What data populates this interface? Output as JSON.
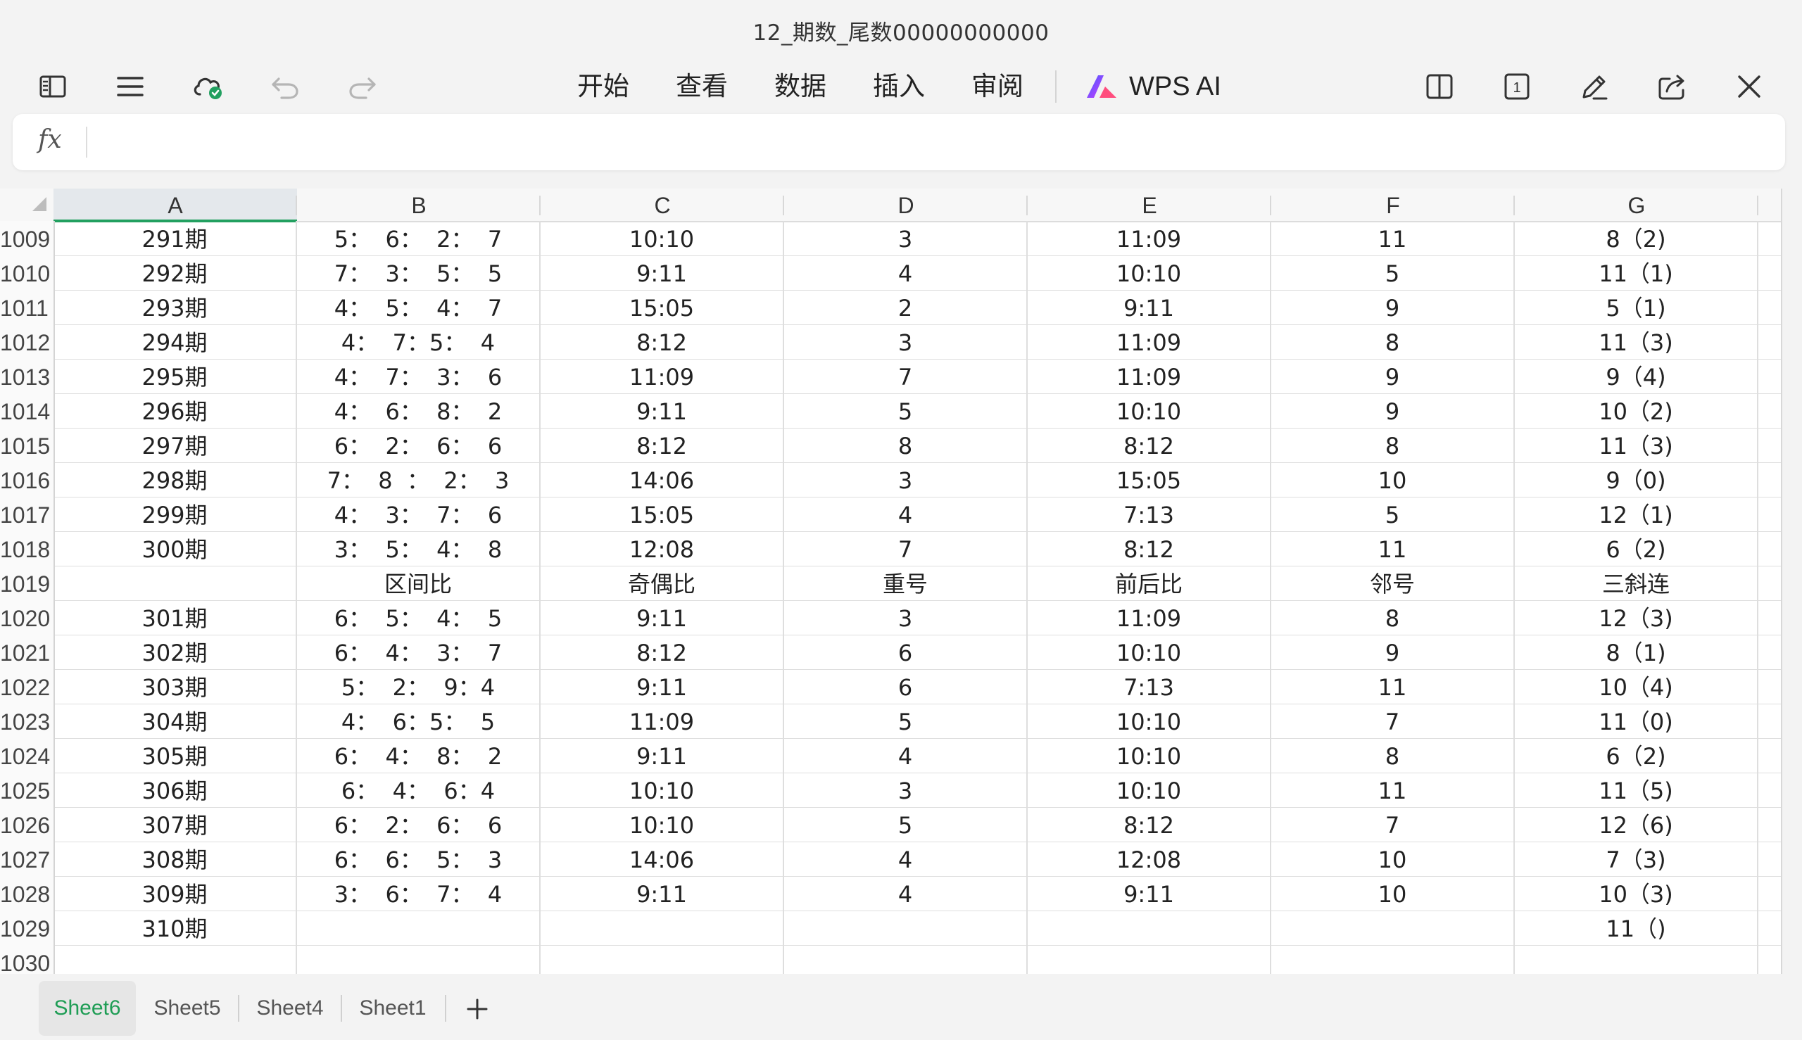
{
  "window": {
    "title": "12_期数_尾数00000000000"
  },
  "toolbar": {
    "left_icons": [
      "sidebar-toggle-icon",
      "menu-icon",
      "cloud-sync-icon",
      "undo-icon",
      "redo-icon"
    ],
    "menu": [
      "开始",
      "查看",
      "数据",
      "插入",
      "审阅"
    ],
    "ai_label": "WPS AI",
    "right_icons": [
      "split-view-icon",
      "page-count-icon",
      "pen-edit-icon",
      "share-icon",
      "close-icon"
    ],
    "page_count": "1"
  },
  "formula_bar": {
    "fx_label": "fx",
    "value": ""
  },
  "columns": [
    "A",
    "B",
    "C",
    "D",
    "E",
    "F",
    "G"
  ],
  "selected_column": "A",
  "rows": [
    {
      "n": "1009",
      "cells": [
        "291期",
        "5：  6：  2：  7",
        "10:10",
        "3",
        "11:09",
        "11",
        "8（2)"
      ]
    },
    {
      "n": "1010",
      "cells": [
        "292期",
        "7：  3：  5：  5",
        "9:11",
        "4",
        "10:10",
        "5",
        "11（1)"
      ]
    },
    {
      "n": "1011",
      "cells": [
        "293期",
        "4：  5：  4：  7",
        "15:05",
        "2",
        "9:11",
        "9",
        "5（1)"
      ]
    },
    {
      "n": "1012",
      "cells": [
        "294期",
        "4：  7：5：  4",
        "8:12",
        "3",
        "11:09",
        "8",
        "11（3)"
      ]
    },
    {
      "n": "1013",
      "cells": [
        "295期",
        "4：  7：  3：  6",
        "11:09",
        "7",
        "11:09",
        "9",
        "9（4)"
      ]
    },
    {
      "n": "1014",
      "cells": [
        "296期",
        "4：  6：  8：  2",
        "9:11",
        "5",
        "10:10",
        "9",
        "10（2)"
      ]
    },
    {
      "n": "1015",
      "cells": [
        "297期",
        "6：  2：  6：  6",
        "8:12",
        "8",
        "8:12",
        "8",
        "11（3)"
      ]
    },
    {
      "n": "1016",
      "cells": [
        "298期",
        "7：  8  ：  2：  3",
        "14:06",
        "3",
        "15:05",
        "10",
        "9（0)"
      ]
    },
    {
      "n": "1017",
      "cells": [
        "299期",
        "4：  3：  7：  6",
        "15:05",
        "4",
        "7:13",
        "5",
        "12（1)"
      ]
    },
    {
      "n": "1018",
      "cells": [
        "300期",
        "3：  5：  4：  8",
        "12:08",
        "7",
        "8:12",
        "11",
        "6（2)"
      ]
    },
    {
      "n": "1019",
      "cells": [
        "",
        "区间比",
        "奇偶比",
        "重号",
        "前后比",
        "邻号",
        "三斜连"
      ]
    },
    {
      "n": "1020",
      "cells": [
        "301期",
        "6：  5：  4：  5",
        "9:11",
        "3",
        "11:09",
        "8",
        "12（3)"
      ]
    },
    {
      "n": "1021",
      "cells": [
        "302期",
        "6：  4：  3：  7",
        "8:12",
        "6",
        "10:10",
        "9",
        "8（1)"
      ]
    },
    {
      "n": "1022",
      "cells": [
        "303期",
        "5：  2：  9：4",
        "9:11",
        "6",
        "7:13",
        "11",
        "10（4)"
      ]
    },
    {
      "n": "1023",
      "cells": [
        "304期",
        "4：  6：5：  5",
        "11:09",
        "5",
        "10:10",
        "7",
        "11（0)"
      ]
    },
    {
      "n": "1024",
      "cells": [
        "305期",
        "6：  4：  8：  2",
        "9:11",
        "4",
        "10:10",
        "8",
        "6（2)"
      ]
    },
    {
      "n": "1025",
      "cells": [
        "306期",
        "6：  4：  6：4",
        "10:10",
        "3",
        "10:10",
        "11",
        "11（5)"
      ]
    },
    {
      "n": "1026",
      "cells": [
        "307期",
        "6：  2：  6：  6",
        "10:10",
        "5",
        "8:12",
        "7",
        "12（6)"
      ]
    },
    {
      "n": "1027",
      "cells": [
        "308期",
        "6：  6：  5：  3",
        "14:06",
        "4",
        "12:08",
        "10",
        "7（3)"
      ]
    },
    {
      "n": "1028",
      "cells": [
        "309期",
        "3：  6：  7：  4",
        "9:11",
        "4",
        "9:11",
        "10",
        "10（3)"
      ]
    },
    {
      "n": "1029",
      "cells": [
        "310期",
        "",
        "",
        "",
        "",
        "",
        "11（)"
      ]
    },
    {
      "n": "1030",
      "cells": [
        "",
        "",
        "",
        "",
        "",
        "",
        ""
      ]
    }
  ],
  "sheets": [
    "Sheet6",
    "Sheet5",
    "Sheet4",
    "Sheet1"
  ],
  "active_sheet": "Sheet6",
  "colors": {
    "accent": "#1f9d55",
    "ai_gradient": [
      "#3b5bff",
      "#d23cff"
    ]
  }
}
